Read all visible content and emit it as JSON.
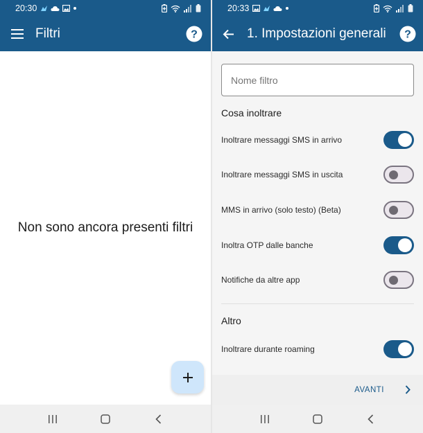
{
  "colors": {
    "primary": "#1a5a8a",
    "fab": "#cfe6fb",
    "switch_off_track": "#ebe6ec"
  },
  "left": {
    "status": {
      "time": "20:30",
      "icons": [
        "messenger-icon",
        "cloud-icon",
        "image-icon",
        "dot-icon",
        "battery-saver-icon",
        "wifi-icon",
        "signal-icon",
        "battery-icon"
      ]
    },
    "appbar": {
      "menu_icon": "hamburger-icon",
      "title": "Filtri",
      "help_icon": "help-circle-icon"
    },
    "empty_message": "Non sono ancora presenti filtri",
    "fab": {
      "icon": "plus-icon",
      "label": "+"
    },
    "nav": [
      "recent-apps-icon",
      "home-icon",
      "back-icon"
    ]
  },
  "right": {
    "status": {
      "time": "20:33",
      "icons": [
        "image-icon",
        "messenger-icon",
        "cloud-icon",
        "dot-icon",
        "battery-saver-icon",
        "wifi-icon",
        "signal-icon",
        "battery-icon"
      ]
    },
    "appbar": {
      "back_icon": "arrow-left-icon",
      "title": "1. Impostazioni generali",
      "help_icon": "help-circle-icon"
    },
    "name_field": {
      "placeholder": "Nome filtro",
      "value": ""
    },
    "section_forward": "Cosa inoltrare",
    "toggles": [
      {
        "label": "Inoltrare messaggi SMS in arrivo",
        "on": true
      },
      {
        "label": "Inoltrare messaggi SMS in uscita",
        "on": false
      },
      {
        "label": "MMS in arrivo (solo testo) (Beta)",
        "on": false
      },
      {
        "label": "Inoltra OTP dalle banche",
        "on": true
      },
      {
        "label": "Notifiche da altre app",
        "on": false
      }
    ],
    "section_other": "Altro",
    "other_toggles": [
      {
        "label": "Inoltrare durante roaming",
        "on": true
      }
    ],
    "footer": {
      "next_label": "AVANTI",
      "next_icon": "chevron-right-icon"
    },
    "nav": [
      "recent-apps-icon",
      "home-icon",
      "back-icon"
    ]
  }
}
